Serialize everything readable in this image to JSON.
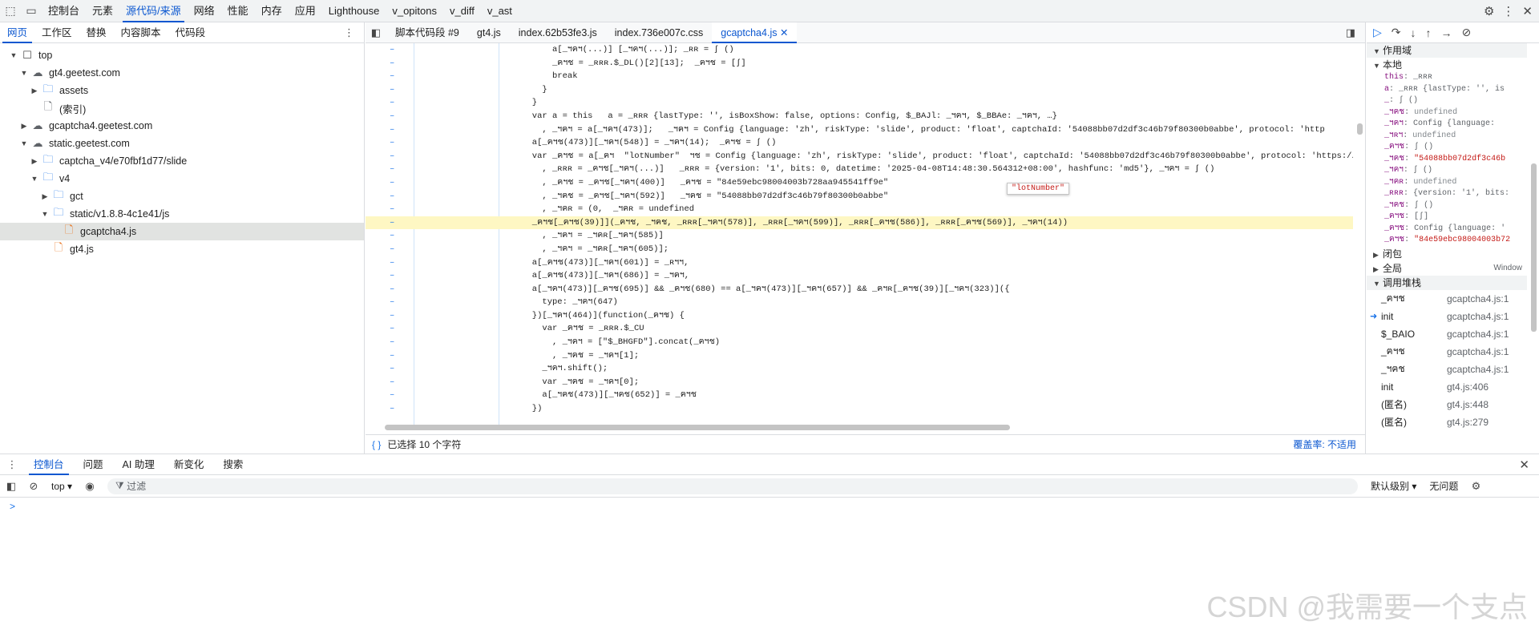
{
  "top_tabs": [
    "控制台",
    "元素",
    "源代码/来源",
    "网络",
    "性能",
    "内存",
    "应用",
    "Lighthouse",
    "v_opitons",
    "v_diff",
    "v_ast"
  ],
  "top_active": "源代码/来源",
  "navigator": {
    "tabs": [
      "网页",
      "工作区",
      "替换",
      "内容脚本",
      "代码段"
    ],
    "tree": [
      {
        "label": "top",
        "depth": 0,
        "icon": "frame",
        "expanded": true
      },
      {
        "label": "gt4.geetest.com",
        "depth": 1,
        "icon": "cloud",
        "expanded": true
      },
      {
        "label": "assets",
        "depth": 2,
        "icon": "folder",
        "expanded": false
      },
      {
        "label": "(索引)",
        "depth": 2,
        "icon": "file"
      },
      {
        "label": "gcaptcha4.geetest.com",
        "depth": 1,
        "icon": "cloud",
        "expanded": false
      },
      {
        "label": "static.geetest.com",
        "depth": 1,
        "icon": "cloud",
        "expanded": true
      },
      {
        "label": "captcha_v4/e70fbf1d77/slide",
        "depth": 2,
        "icon": "folder",
        "expanded": false
      },
      {
        "label": "v4",
        "depth": 2,
        "icon": "folder",
        "expanded": true
      },
      {
        "label": "gct",
        "depth": 3,
        "icon": "folder",
        "expanded": false
      },
      {
        "label": "static/v1.8.8-4c1e41/js",
        "depth": 3,
        "icon": "folder",
        "expanded": true
      },
      {
        "label": "gcaptcha4.js",
        "depth": 4,
        "icon": "js",
        "selected": true
      },
      {
        "label": "gt4.js",
        "depth": 3,
        "icon": "js"
      }
    ]
  },
  "editor": {
    "tabs": [
      "脚本代码段 #9",
      "gt4.js",
      "index.62b53fe3.js",
      "index.736e007c.css",
      "gcaptcha4.js"
    ],
    "active_tab": "gcaptcha4.js",
    "lines": [
      "          a[_ฯคฯ(...)] [_ฯคฯ(...)]; _ʀʀ = ʃ ()",
      "          _ฅฯช = _ʀʀʀ.$_DL()[2][13];  _ฅฯช = [ʃ]",
      "          break",
      "        }",
      "      }",
      "      var a = this   a = _ʀʀʀ {lastType: '', isBoxShow: false, options: Config, $_BAJl: _ฯฅฯ, $_BBAe: _ฯฅฯ, …}",
      "        , _ฯฅฯ = a[_ฯคฯ(473)];   _ฯฅฯ = Config {language: 'zh', riskType: 'slide', product: 'float', captchaId: '54088bb07d2df3c46b79f80300b0abbe', protocol: 'http",
      "      a[_ฅฯช(473)][_ฯคฯ(548)] = _ฯคฯ(14);  _ฅฯช = ʃ ()",
      "      var _ฅฯช = a[_ฅฯ  \"lotNumber\"  ฯช = Config {language: 'zh', riskType: 'slide', product: 'float', captchaId: '54088bb07d2df3c46b79f80300b0abbe', protocol: 'https://",
      "        , _ʀʀʀ = _ฅฯช[_ฯคฯ(...)]   _ʀʀʀ = {version: '1', bits: 0, datetime: '2025-04-08T14:48:30.564312+08:00', hashfunc: 'md5'}, _ฯคฯ = ʃ ()",
      "        , _ฅฯช = _ฅฯช[_ฯคฯ(400)]   _ฅฯช = \"84e59ebc98004003b728aa945541ff9e\"",
      "        , _ฯฅช = _ฅฯช[_ฯคฯ(592)]   _ฯฅช = \"54088bb07d2df3c46b79f80300b0abbe\"",
      "        , _ฯคʀ = (0,  _ฯคʀ = undefined",
      "      _ฅฯช[_ฅฯช(39)]](_ฅฯช, _ฯฅช, _ʀʀʀ[_ฯคฯ(578)], _ʀʀʀ[_ฯคฯ(599)], _ʀʀʀ[_ฅฯช(586)], _ʀʀʀ[_ฅฯช(569)], _ฯคฯ(14))",
      "        , _ฯฅฯ = _ฯคʀ[_ฯคฯ(585)]",
      "        , _ฯคฯ = _ฯคʀ[_ฯคฯ(605)];",
      "      a[_ฅฯช(473)][_ฯคฯ(601)] = _ʀฯฯ,",
      "      a[_ฅฯช(473)][_ฯคฯ(686)] = _ฯฅฯ,",
      "      a[_ฯคฯ(473)][_ฅฯช(695)] && _ฅฯช(680) == a[_ฯคฯ(473)][_ฯคฯ(657)] && _ฅฯʀ[_ฅฯช(39)][_ฯคฯ(323)]({",
      "        type: _ฯคฯ(647)",
      "      })[_ฯคฯ(464)](function(_ฅฯช) {",
      "        var _ฅฯช = _ʀʀʀ.$_CU",
      "          , _ฯคฯ = [\"$_BHGFD\"].concat(_ฅฯช)",
      "          , _ฯฅช = _ฯคฯ[1];",
      "        _ฯคฯ.shift();",
      "        var _ฯฅช = _ฯคฯ[0];",
      "        a[_ฯฅช(473)][_ฯฅช(652)] = _ฅฯช",
      "      })"
    ],
    "highlight_line": 13,
    "tooltip": "\"lotNumber\"",
    "status_selection": "已选择 10 个字符",
    "status_coverage": "覆盖率: 不适用"
  },
  "debugger": {
    "scope_header": "作用域",
    "local_label": "本地",
    "props": [
      {
        "k": "this",
        "v": "_ʀʀʀ"
      },
      {
        "k": "a",
        "v": "_ʀʀʀ {lastType: '', is"
      },
      {
        "k": "_",
        "v": "ʃ ()"
      },
      {
        "k": "_ฯฅช",
        "v": "undefined"
      },
      {
        "k": "_ฯฅฯ",
        "v": "Config {language:"
      },
      {
        "k": "_ฯʀฯ",
        "v": "undefined"
      },
      {
        "k": "_ฅฯช",
        "v": "ʃ ()"
      },
      {
        "k": "_ฯฅช",
        "v": "\"54088bb07d2df3c46b"
      },
      {
        "k": "_ฯคฯ",
        "v": "ʃ ()"
      },
      {
        "k": "_ฯคʀ",
        "v": "undefined"
      },
      {
        "k": "_ʀʀʀ",
        "v": "{version: '1', bits:"
      },
      {
        "k": "_ฯฅช",
        "v": "ʃ ()"
      },
      {
        "k": "_ฅฯช",
        "v": "[ʃ]"
      },
      {
        "k": "_ฅฯช",
        "v": "Config {language: '"
      },
      {
        "k": "_ฅฯช",
        "v": "\"84e59ebc98004003b72"
      }
    ],
    "closure_label": "闭包",
    "global_label": "全局",
    "global_value": "Window",
    "stack_label": "调用堆栈",
    "stack": [
      {
        "fn": "_ฅฯช",
        "loc": "gcaptcha4.js:1"
      },
      {
        "fn": "init",
        "loc": "gcaptcha4.js:1",
        "current": true
      },
      {
        "fn": "$_BAIO",
        "loc": "gcaptcha4.js:1"
      },
      {
        "fn": "_ฅฯช",
        "loc": "gcaptcha4.js:1"
      },
      {
        "fn": "_ฯฅช",
        "loc": "gcaptcha4.js:1"
      },
      {
        "fn": "init",
        "loc": "gt4.js:406"
      },
      {
        "fn": "(匿名)",
        "loc": "gt4.js:448"
      },
      {
        "fn": "(匿名)",
        "loc": "gt4.js:279"
      }
    ]
  },
  "drawer": {
    "tabs": [
      "控制台",
      "问题",
      "AI 助理",
      "新变化",
      "搜索"
    ],
    "active_tab": "控制台",
    "context": "top",
    "filter_placeholder": "过滤",
    "level": "默认级别",
    "issues": "无问题",
    "prompt": ">"
  },
  "watermark": "CSDN @我需要一个支点"
}
